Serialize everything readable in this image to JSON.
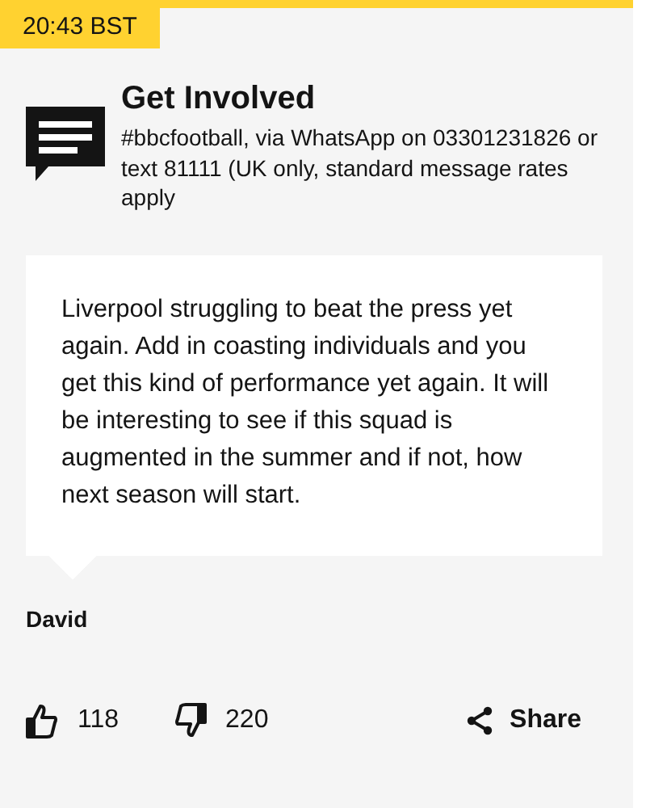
{
  "timestamp": "20:43 BST",
  "get_involved": {
    "title": "Get Involved",
    "text": "#bbcfootball, via WhatsApp on 03301231826 or text 81111 (UK only, standard message rates apply"
  },
  "comment": {
    "text": "Liverpool struggling to beat the press yet again. Add in coasting individuals and you get this kind of performance yet again. It will be interesting to see if this squad is augmented in the summer and if not, how next season will start.",
    "author": "David"
  },
  "reactions": {
    "likes": "118",
    "dislikes": "220",
    "share": "Share"
  }
}
